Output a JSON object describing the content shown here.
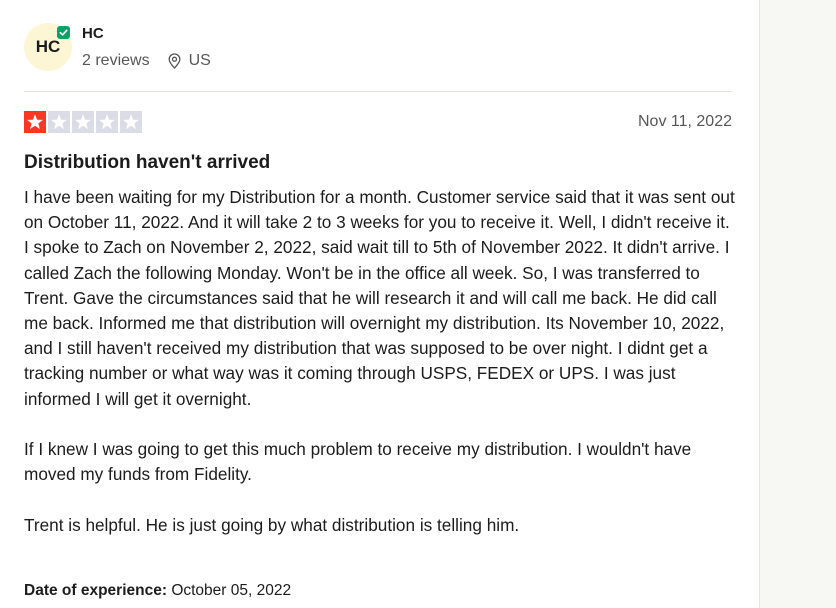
{
  "reviewer": {
    "initials": "HC",
    "name": "HC",
    "reviews_count": "2 reviews",
    "country": "US"
  },
  "review": {
    "rating": 1,
    "max_rating": 5,
    "date": "Nov 11, 2022",
    "title": "Distribution haven't arrived",
    "paragraphs": [
      "I have been waiting for my Distribution for a month. Customer service said that it was sent out on October 11, 2022. And it will take 2 to 3 weeks for you to receive it. Well, I didn't receive it. I spoke to Zach on November 2, 2022, said wait till to 5th of November 2022. It didn't arrive. I called Zach the following Monday. Won't be in the office all week. So, I was transferred to Trent. Gave the circumstances said that he will research it and will call me back. He did call me back. Informed me that distribution will overnight my distribution. Its November 10, 2022, and I still haven't received my distribution that was supposed to be over night. I didnt get a tracking number or what way was it coming through USPS, FEDEX or UPS. I was just informed I will get it overnight.",
      "If I knew I was going to get this much problem to receive my distribution. I wouldn't have moved my funds from Fidelity.",
      "Trent is helpful. He is just going by what distribution is telling him."
    ],
    "experience_label": "Date of experience:",
    "experience_date": "October 05, 2022"
  },
  "colors": {
    "star_filled": "#ff3722",
    "star_empty": "#dcdce6",
    "verified": "#04a269",
    "avatar_bg": "#fdf6d4"
  },
  "icons": {
    "verified": "verified-check-icon",
    "location": "location-pin-icon",
    "star": "star-icon"
  }
}
